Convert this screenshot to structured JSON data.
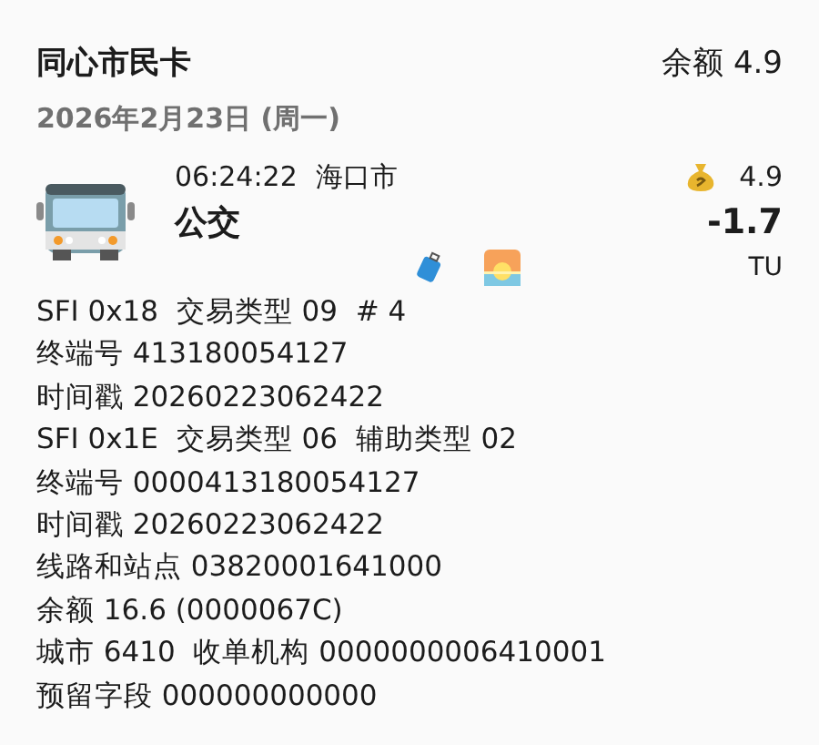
{
  "card": {
    "title": "同心市民卡",
    "balance": "余额 4.9"
  },
  "date": "2026年2月23日 (周一)",
  "transaction": {
    "time": "06:24:22",
    "city": "海口市",
    "category": "公交",
    "balance_after": "4.9",
    "amount": "-1.7",
    "currency": "TU"
  },
  "details": [
    "SFI 0x18  交易类型 09  # 4",
    "终端号 413180054127",
    "时间戳 20260223062422",
    "SFI 0x1E  交易类型 06  辅助类型 02",
    "终端号 0000413180054127",
    "时间戳 20260223062422",
    "线路和站点 03820001641000",
    "余额 16.6 (0000067C)",
    "城市 6410  收单机构 0000000006410001",
    "预留字段 000000000000"
  ]
}
